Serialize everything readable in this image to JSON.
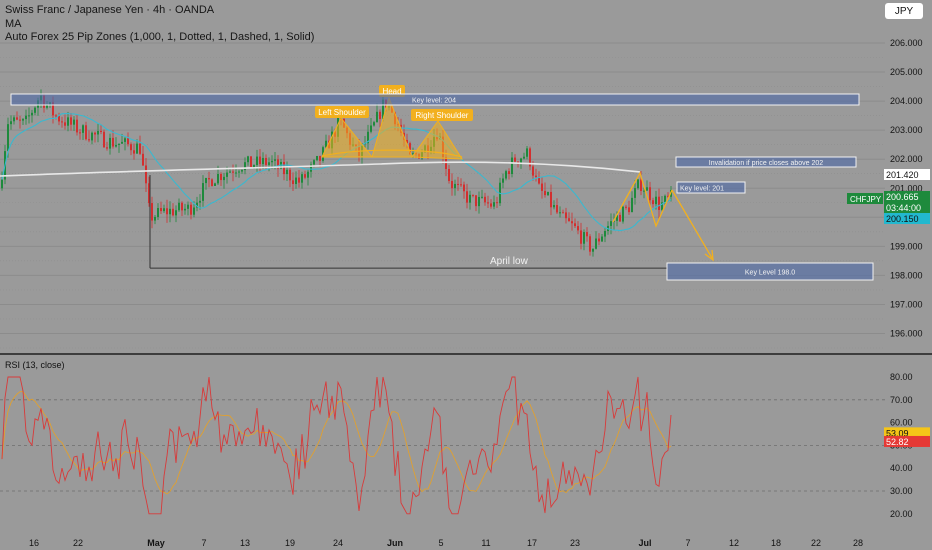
{
  "header": {
    "title": "Swiss Franc / Japanese Yen · 4h · OANDA",
    "indicator1": "MA",
    "indicator2": "Auto Forex 25 Pip Zones (1,000, 1, Dotted, 1, Dashed, 1, Solid)",
    "currency": "JPY"
  },
  "chart_data": {
    "type": "candlestick",
    "symbol": "CHFJPY",
    "timeframe": "4h",
    "price_axis_ticks": [
      "206.000",
      "205.000",
      "204.000",
      "203.000",
      "202.000",
      "201.000",
      "200.000",
      "199.000",
      "198.000",
      "197.000",
      "196.000"
    ],
    "price_axis_values": [
      206,
      205,
      204,
      203,
      202,
      201,
      200,
      199,
      198,
      197,
      196
    ],
    "price_range": [
      195.5,
      206.5
    ],
    "x_tick_labels": [
      "16",
      "22",
      "May",
      "7",
      "13",
      "19",
      "24",
      "Jun",
      "5",
      "11",
      "17",
      "23",
      "Jul",
      "7",
      "12",
      "18",
      "22",
      "28"
    ],
    "price_markers": [
      {
        "label": "201.420",
        "value": 201.42,
        "color": "#ffffff",
        "text_color": "#111111"
      },
      {
        "label": "CHFJPY",
        "value": 200.665,
        "color": "#1e8a3c",
        "text_color": "#ffffff"
      },
      {
        "label": "200.665",
        "value": 200.665,
        "color": "#1e8a3c",
        "text_color": "#ffffff"
      },
      {
        "label": "03:44:00",
        "value": 200.4,
        "color": "#1e8a3c",
        "text_color": "#ffffff"
      },
      {
        "label": "200.150",
        "value": 200.15,
        "color": "#22b8cf",
        "text_color": "#111111"
      }
    ],
    "annotations": [
      {
        "text": "Key level: 204",
        "kind": "zone"
      },
      {
        "text": "Invalidation if price closes above 202",
        "kind": "zone"
      },
      {
        "text": "Key level: 201",
        "kind": "zone"
      },
      {
        "text": "Key Level 198.0",
        "kind": "zone"
      },
      {
        "text": "Left Shoulder",
        "kind": "label"
      },
      {
        "text": "Head",
        "kind": "label"
      },
      {
        "text": "Right Shoulder",
        "kind": "label"
      },
      {
        "text": "April  low",
        "kind": "text",
        "value": 198.25
      }
    ],
    "colors": {
      "up": "#1e8a3c",
      "down": "#d32f2f",
      "ma_fast": "#39b9d0",
      "ma_slow": "#e8e8e8",
      "pattern": "#f2b01e",
      "zone_fill": "#4f6aa8"
    }
  },
  "rsi": {
    "title": "RSI (13, close)",
    "ticks": [
      "80.00",
      "70.00",
      "60.00",
      "50.00",
      "40.00",
      "30.00",
      "20.00"
    ],
    "tick_values": [
      80,
      70,
      60,
      50,
      40,
      30,
      20
    ],
    "range": [
      15,
      85
    ],
    "levels": [
      70,
      50,
      30
    ],
    "current_labels": [
      {
        "label": "53.09",
        "value": 53.09,
        "color": "#f5c518"
      },
      {
        "label": "52.82",
        "value": 52.82,
        "color": "#e53935"
      }
    ],
    "series_colors": {
      "rsi": "#d83a3a",
      "ma": "#e0a030"
    }
  }
}
